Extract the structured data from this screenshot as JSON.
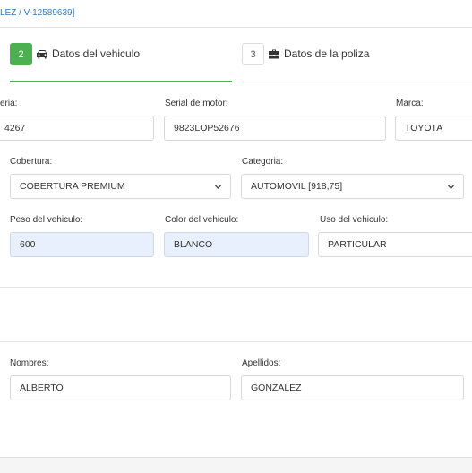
{
  "breadcrumb": "LEZ / V-12589639]",
  "steps": [
    {
      "number": "2",
      "label": "Datos del vehiculo"
    },
    {
      "number": "3",
      "label": "Datos de la poliza"
    }
  ],
  "vehicle": {
    "serial_carroceria_label": "eria:",
    "serial_carroceria_value": "4267",
    "serial_motor_label": "Serial de motor:",
    "serial_motor_value": "9823LOP52676",
    "marca_label": "Marca:",
    "marca_value": "TOYOTA",
    "cobertura_label": "Cobertura:",
    "cobertura_value": "COBERTURA PREMIUM",
    "categoria_label": "Categoria:",
    "categoria_value": "AUTOMOVIL [918,75]",
    "peso_label": "Peso del vehiculo:",
    "peso_value": "600",
    "color_label": "Color del vehiculo:",
    "color_value": "BLANCO",
    "uso_label": "Uso del vehiculo:",
    "uso_value": "PARTICULAR"
  },
  "owner": {
    "nombres_label": "Nombres:",
    "nombres_value": "ALBERTO",
    "apellidos_label": "Apellidos:",
    "apellidos_value": "GONZALEZ"
  },
  "colors": {
    "accent": "#4caf50",
    "link": "#337ab7",
    "readonly_bg": "#e8f0fe"
  }
}
